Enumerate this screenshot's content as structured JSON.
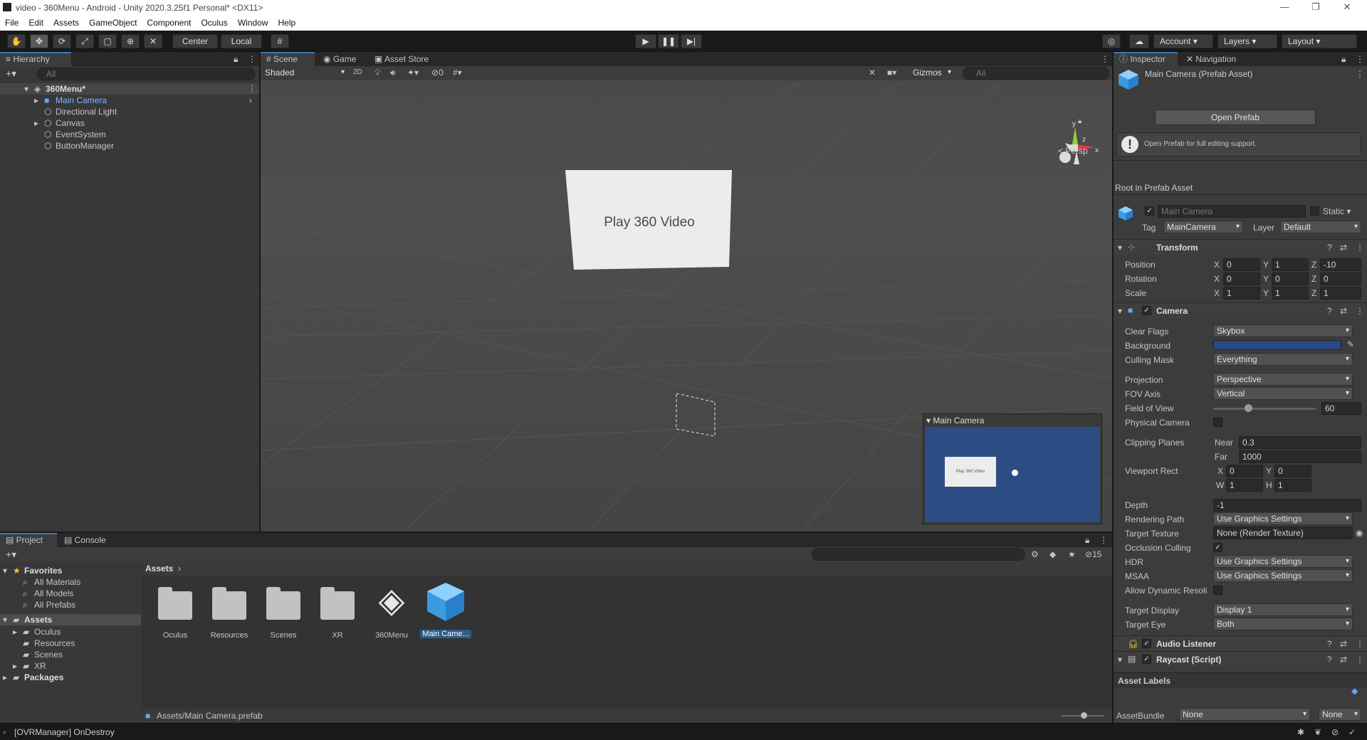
{
  "window": {
    "title": "video - 360Menu - Android - Unity 2020.3.25f1 Personal* <DX11>",
    "minimize": "—",
    "maximize": "❐",
    "close": "✕"
  },
  "menu": [
    "File",
    "Edit",
    "Assets",
    "GameObject",
    "Component",
    "Oculus",
    "Window",
    "Help"
  ],
  "toolbar": {
    "center": "Center",
    "local": "Local",
    "account": "Account",
    "layers": "Layers",
    "layout": "Layout"
  },
  "hierarchy": {
    "tab": "Hierarchy",
    "search": "All",
    "scene": "360Menu*",
    "items": [
      "Main Camera",
      "Directional Light",
      "Canvas",
      "EventSystem",
      "ButtonManager"
    ]
  },
  "scene": {
    "tabs": [
      "Scene",
      "Game",
      "Asset Store"
    ],
    "shading": "Shaded",
    "mode2d": "2D",
    "hidden_count": "0",
    "gizmos": "Gizmos",
    "search": "All",
    "persp": "Persp",
    "button_text": "Play 360 Video",
    "axis_x": "x",
    "axis_y": "y",
    "axis_z": "z",
    "preview_title": "Main Camera",
    "preview_button": "Play 360 Video"
  },
  "project": {
    "tabs": [
      "Project",
      "Console"
    ],
    "favorites": "Favorites",
    "fav_items": [
      "All Materials",
      "All Models",
      "All Prefabs"
    ],
    "assets": "Assets",
    "asset_folders": [
      "Oculus",
      "Resources",
      "Scenes",
      "XR"
    ],
    "packages": "Packages",
    "breadcrumb": "Assets",
    "grid": [
      "Oculus",
      "Resources",
      "Scenes",
      "XR",
      "360Menu",
      "Main Came..."
    ],
    "path": "Assets/Main Camera.prefab",
    "hidden_count": "15"
  },
  "inspector": {
    "tabs": [
      "Inspector",
      "Navigation"
    ],
    "title": "Main Camera (Prefab Asset)",
    "open_prefab": "Open Prefab",
    "help": "Open Prefab for full editing support.",
    "root_label": "Root in Prefab Asset",
    "name": "Main Camera",
    "static": "Static",
    "tag_label": "Tag",
    "tag": "MainCamera",
    "layer_label": "Layer",
    "layer": "Default",
    "transform": {
      "title": "Transform",
      "rows": [
        {
          "label": "Position",
          "x": "0",
          "y": "1",
          "z": "-10"
        },
        {
          "label": "Rotation",
          "x": "0",
          "y": "0",
          "z": "0"
        },
        {
          "label": "Scale",
          "x": "1",
          "y": "1",
          "z": "1"
        }
      ]
    },
    "camera": {
      "title": "Camera",
      "clear_flags": "Clear Flags",
      "clear_flags_v": "Skybox",
      "background": "Background",
      "background_color": "#284983",
      "culling": "Culling Mask",
      "culling_v": "Everything",
      "projection": "Projection",
      "projection_v": "Perspective",
      "fov_axis": "FOV Axis",
      "fov_axis_v": "Vertical",
      "fov": "Field of View",
      "fov_v": "60",
      "physical": "Physical Camera",
      "clipping": "Clipping Planes",
      "near": "Near",
      "near_v": "0.3",
      "far": "Far",
      "far_v": "1000",
      "viewport": "Viewport Rect",
      "vx": "0",
      "vy": "0",
      "vw": "1",
      "vh": "1",
      "depth": "Depth",
      "depth_v": "-1",
      "rendering": "Rendering Path",
      "rendering_v": "Use Graphics Settings",
      "target_texture": "Target Texture",
      "target_texture_v": "None (Render Texture)",
      "occlusion": "Occlusion Culling",
      "hdr": "HDR",
      "hdr_v": "Use Graphics Settings",
      "msaa": "MSAA",
      "msaa_v": "Use Graphics Settings",
      "dynamic": "Allow Dynamic Resoli",
      "target_display": "Target Display",
      "target_display_v": "Display 1",
      "target_eye": "Target Eye",
      "target_eye_v": "Both"
    },
    "audio": "Audio Listener",
    "raycast": "Raycast (Script)",
    "asset_labels": "Asset Labels",
    "assetbundle": "AssetBundle",
    "ab_v": "None",
    "ab_v2": "None"
  },
  "status": {
    "text": "[OVRManager] OnDestroy"
  }
}
